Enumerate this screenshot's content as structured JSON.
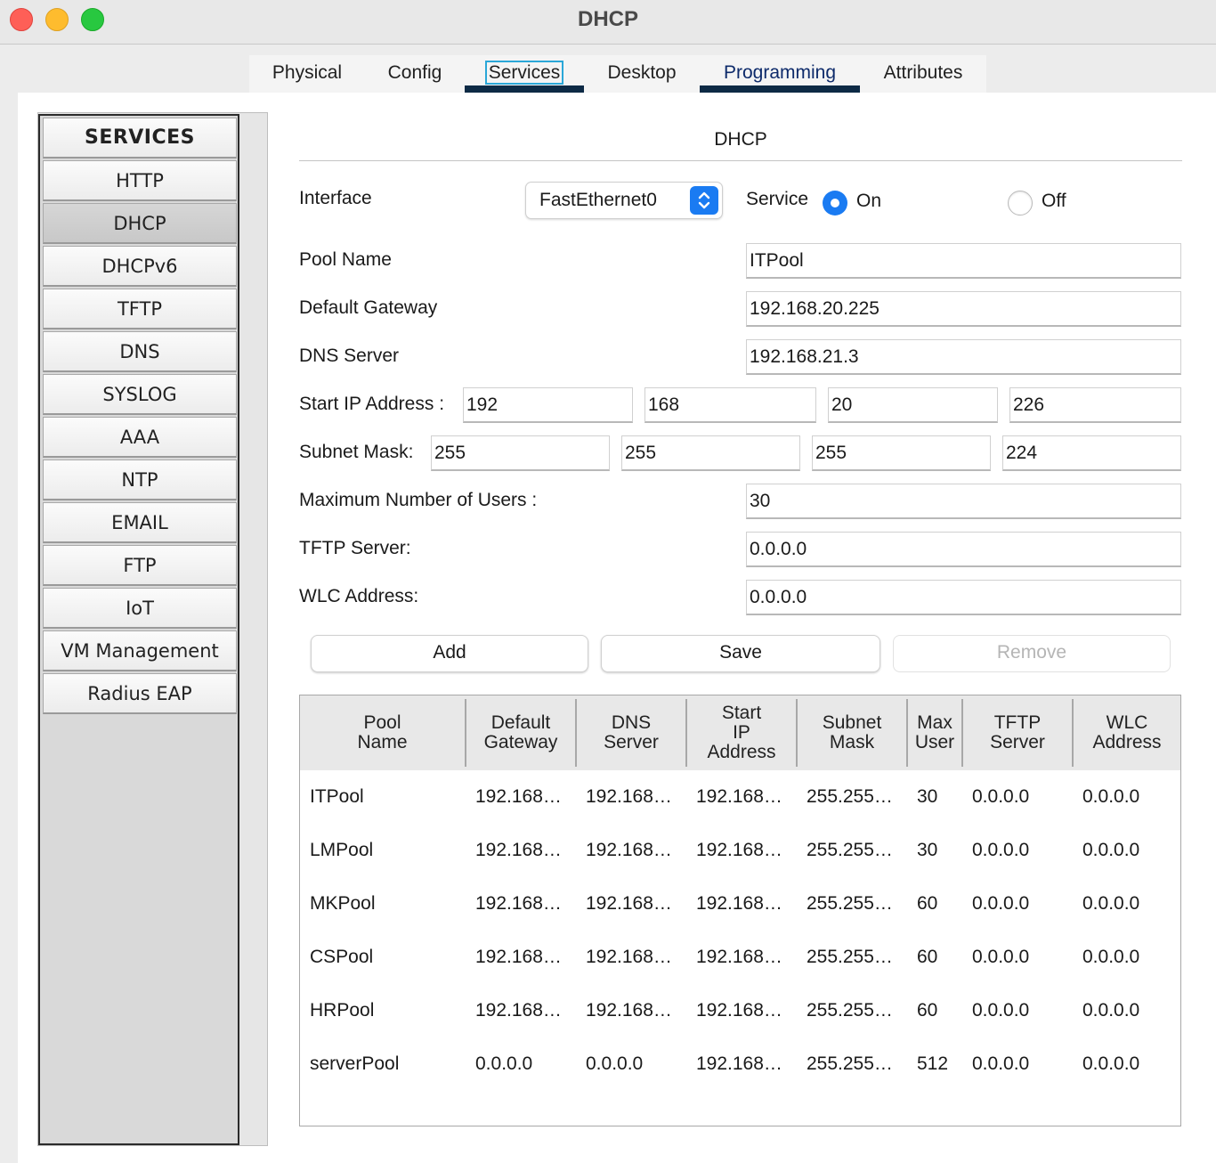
{
  "window": {
    "title": "DHCP"
  },
  "tabs": [
    {
      "label": "Physical"
    },
    {
      "label": "Config"
    },
    {
      "label": "Services"
    },
    {
      "label": "Desktop"
    },
    {
      "label": "Programming"
    },
    {
      "label": "Attributes"
    }
  ],
  "sidebar": {
    "header": "SERVICES",
    "items": [
      {
        "label": "HTTP"
      },
      {
        "label": "DHCP"
      },
      {
        "label": "DHCPv6"
      },
      {
        "label": "TFTP"
      },
      {
        "label": "DNS"
      },
      {
        "label": "SYSLOG"
      },
      {
        "label": "AAA"
      },
      {
        "label": "NTP"
      },
      {
        "label": "EMAIL"
      },
      {
        "label": "FTP"
      },
      {
        "label": "IoT"
      },
      {
        "label": "VM Management"
      },
      {
        "label": "Radius EAP"
      }
    ]
  },
  "form": {
    "section_title": "DHCP",
    "interface_label": "Interface",
    "interface_value": "FastEthernet0",
    "service_label": "Service",
    "service_on": "On",
    "service_off": "Off",
    "pool_name_label": "Pool Name",
    "pool_name_value": "ITPool",
    "gateway_label": "Default Gateway",
    "gateway_value": "192.168.20.225",
    "dns_label": "DNS Server",
    "dns_value": "192.168.21.3",
    "start_ip_label": "Start IP Address :",
    "start_ip": [
      "192",
      "168",
      "20",
      "226"
    ],
    "subnet_label": "Subnet Mask:",
    "subnet": [
      "255",
      "255",
      "255",
      "224"
    ],
    "max_users_label": "Maximum Number of Users :",
    "max_users_value": "30",
    "tftp_label": "TFTP Server:",
    "tftp_value": "0.0.0.0",
    "wlc_label": "WLC Address:",
    "wlc_value": "0.0.0.0"
  },
  "buttons": {
    "add": "Add",
    "save": "Save",
    "remove": "Remove"
  },
  "table": {
    "headers": [
      {
        "l1": "Pool",
        "l2": "Name",
        "l3": ""
      },
      {
        "l1": "Default",
        "l2": "Gateway",
        "l3": ""
      },
      {
        "l1": "DNS",
        "l2": "Server",
        "l3": ""
      },
      {
        "l1": "Start",
        "l2": "IP",
        "l3": "Address"
      },
      {
        "l1": "Subnet",
        "l2": "Mask",
        "l3": ""
      },
      {
        "l1": "Max",
        "l2": "User",
        "l3": ""
      },
      {
        "l1": "TFTP",
        "l2": "Server",
        "l3": ""
      },
      {
        "l1": "WLC",
        "l2": "Address",
        "l3": ""
      }
    ],
    "rows": [
      [
        "ITPool",
        "192.168…",
        "192.168…",
        "192.168…",
        "255.255…",
        "30",
        "0.0.0.0",
        "0.0.0.0"
      ],
      [
        "LMPool",
        "192.168…",
        "192.168…",
        "192.168…",
        "255.255…",
        "30",
        "0.0.0.0",
        "0.0.0.0"
      ],
      [
        "MKPool",
        "192.168…",
        "192.168…",
        "192.168…",
        "255.255…",
        "60",
        "0.0.0.0",
        "0.0.0.0"
      ],
      [
        "CSPool",
        "192.168…",
        "192.168…",
        "192.168…",
        "255.255…",
        "60",
        "0.0.0.0",
        "0.0.0.0"
      ],
      [
        "HRPool",
        "192.168…",
        "192.168…",
        "192.168…",
        "255.255…",
        "60",
        "0.0.0.0",
        "0.0.0.0"
      ],
      [
        "serverPool",
        "0.0.0.0",
        "0.0.0.0",
        "192.168…",
        "255.255…",
        "512",
        "0.0.0.0",
        "0.0.0.0"
      ]
    ]
  }
}
